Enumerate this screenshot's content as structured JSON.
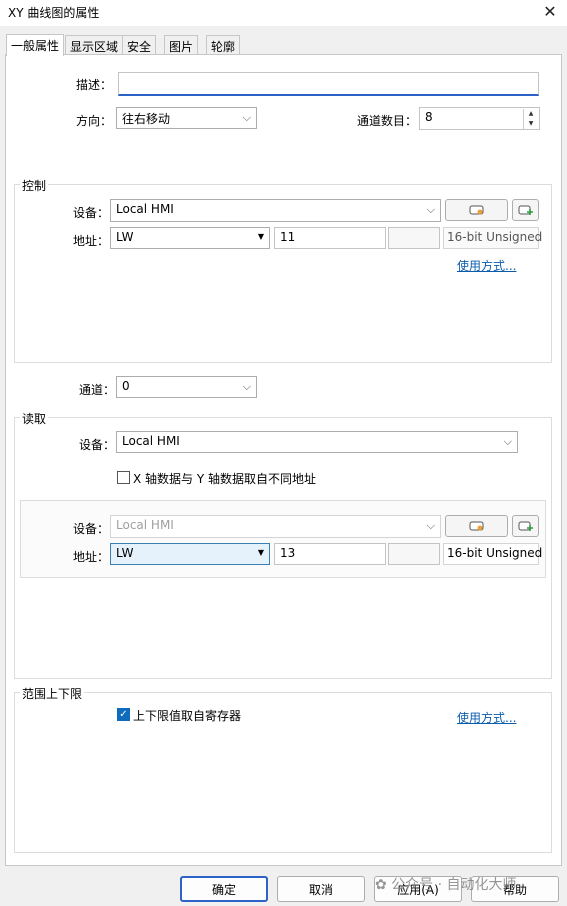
{
  "window": {
    "title": "XY 曲线图的属性",
    "close_glyph": "✕"
  },
  "tabs": [
    "一般属性",
    "显示区域",
    "安全",
    "图片",
    "轮廓"
  ],
  "general": {
    "description_label": "描述：",
    "description_value": "",
    "direction_label": "方向：",
    "direction_value": "往右移动",
    "channel_count_label": "通道数目：",
    "channel_count_value": "8"
  },
  "control": {
    "title": "控制",
    "device_label": "设备：",
    "device_value": "Local HMI",
    "address_label": "地址：",
    "address_type": "LW",
    "address_value": "11",
    "data_type": "16-bit Unsigned",
    "usage_link": "使用方式..."
  },
  "channel": {
    "label": "通道：",
    "value": "0"
  },
  "read": {
    "title": "读取",
    "device_label": "设备：",
    "device_value": "Local HMI",
    "xy_diff_label": "X 轴数据与 Y 轴数据取自不同地址",
    "xy_diff_checked": false,
    "sub_device_label": "设备：",
    "sub_device_value": "Local HMI",
    "address_label": "地址：",
    "address_type": "LW",
    "address_value": "13",
    "data_type": "16-bit Unsigned"
  },
  "range": {
    "title": "范围上下限",
    "from_register_label": "上下限值取自寄存器",
    "from_register_checked": true,
    "usage_link": "使用方式..."
  },
  "buttons": {
    "ok": "确定",
    "cancel": "取消",
    "apply": "应用(A)",
    "help": "帮助"
  },
  "watermark": "公众号 · 自动化大师",
  "colors": {
    "accent": "#2d62c7",
    "link": "#0b5cad",
    "checkbox_on": "#0f6cbd"
  }
}
